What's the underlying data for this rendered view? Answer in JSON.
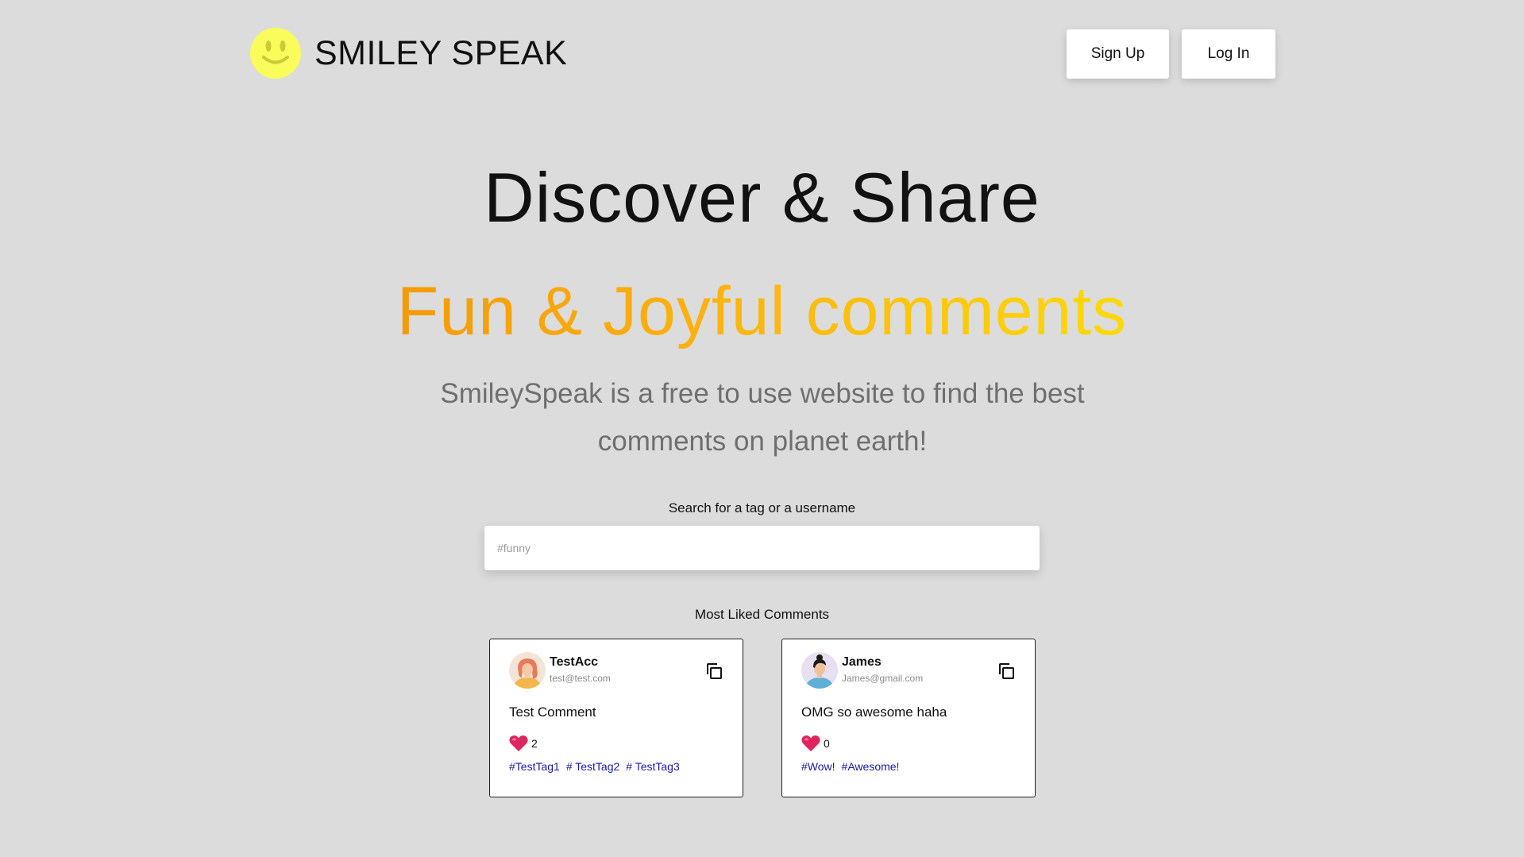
{
  "brand": {
    "name": "SMILEY SPEAK",
    "logo_icon": "smiley-face-icon",
    "logo_color": "#f9fc5a"
  },
  "header": {
    "signup_label": "Sign Up",
    "login_label": "Log In"
  },
  "hero": {
    "title": "Discover & Share",
    "subtitle": "Fun & Joyful comments",
    "description": "SmileySpeak is a free to use website to find the best comments on planet earth!",
    "subtitle_gradient": [
      "#f59a06",
      "#fcd90a"
    ]
  },
  "search": {
    "label": "Search for a tag or a username",
    "placeholder": "#funny",
    "value": ""
  },
  "feed": {
    "title": "Most Liked Comments",
    "cards": [
      {
        "username": "TestAcc",
        "email": "test@test.com",
        "comment": "Test Comment",
        "likes": "2",
        "tags": [
          "#TestTag1",
          "# TestTag2",
          "# TestTag3"
        ],
        "avatar_icon": "avatar-woman-icon"
      },
      {
        "username": "James",
        "email": "James@gmail.com",
        "comment": "OMG so awesome haha",
        "likes": "0",
        "tags": [
          "#Wow!",
          "#Awesome!"
        ],
        "avatar_icon": "avatar-man-icon"
      }
    ]
  },
  "colors": {
    "background": "#dcdcdc",
    "heart": "#e0245e",
    "tag": "#1a1aa8"
  }
}
